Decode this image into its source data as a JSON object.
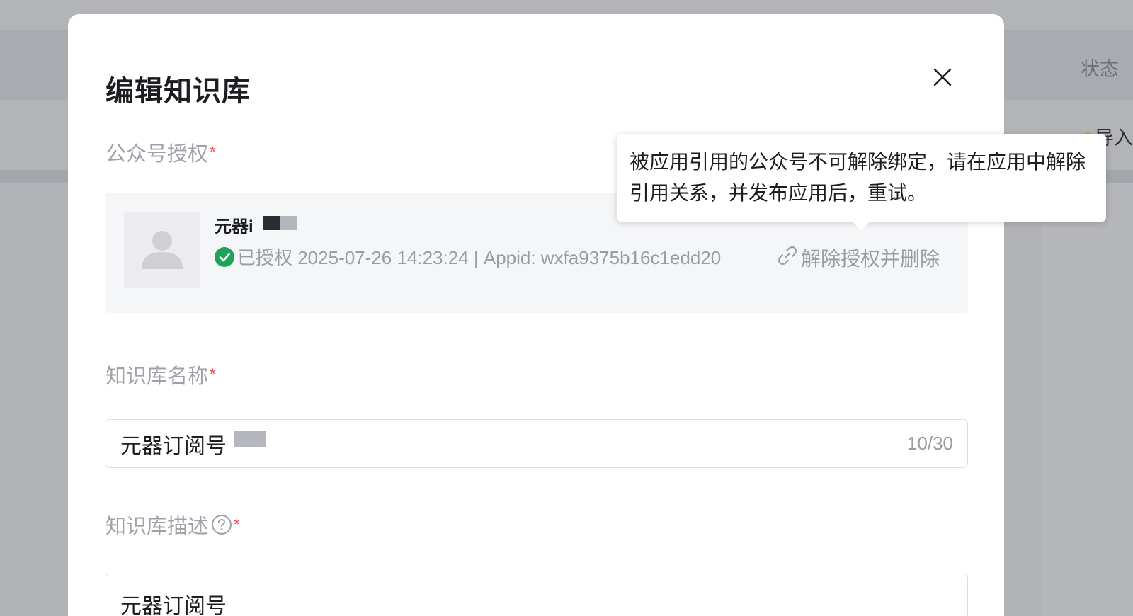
{
  "background": {
    "status_header": "状态",
    "import_label": "导入"
  },
  "modal": {
    "title": "编辑知识库",
    "close_icon": "close-icon",
    "auth_section": {
      "label": "公众号授权",
      "required_mark": "*",
      "account_name": "元器i",
      "status_text": "已授权 2025-07-26 14:23:24 | Appid: wxfa9375b16c1edd20",
      "unbind_label": "解除授权并删除"
    },
    "tooltip": {
      "text": "被应用引用的公众号不可解除绑定，请在应用中解除引用关系，并发布应用后，重试。"
    },
    "name_section": {
      "label": "知识库名称",
      "required_mark": "*",
      "value": "元器订阅号",
      "counter": "10/30"
    },
    "desc_section": {
      "label": "知识库描述",
      "required_mark": "*",
      "value": "元器订阅号"
    }
  },
  "colors": {
    "required": "#e5484d",
    "success": "#1fa35b",
    "muted_text": "#9a9ca3"
  }
}
